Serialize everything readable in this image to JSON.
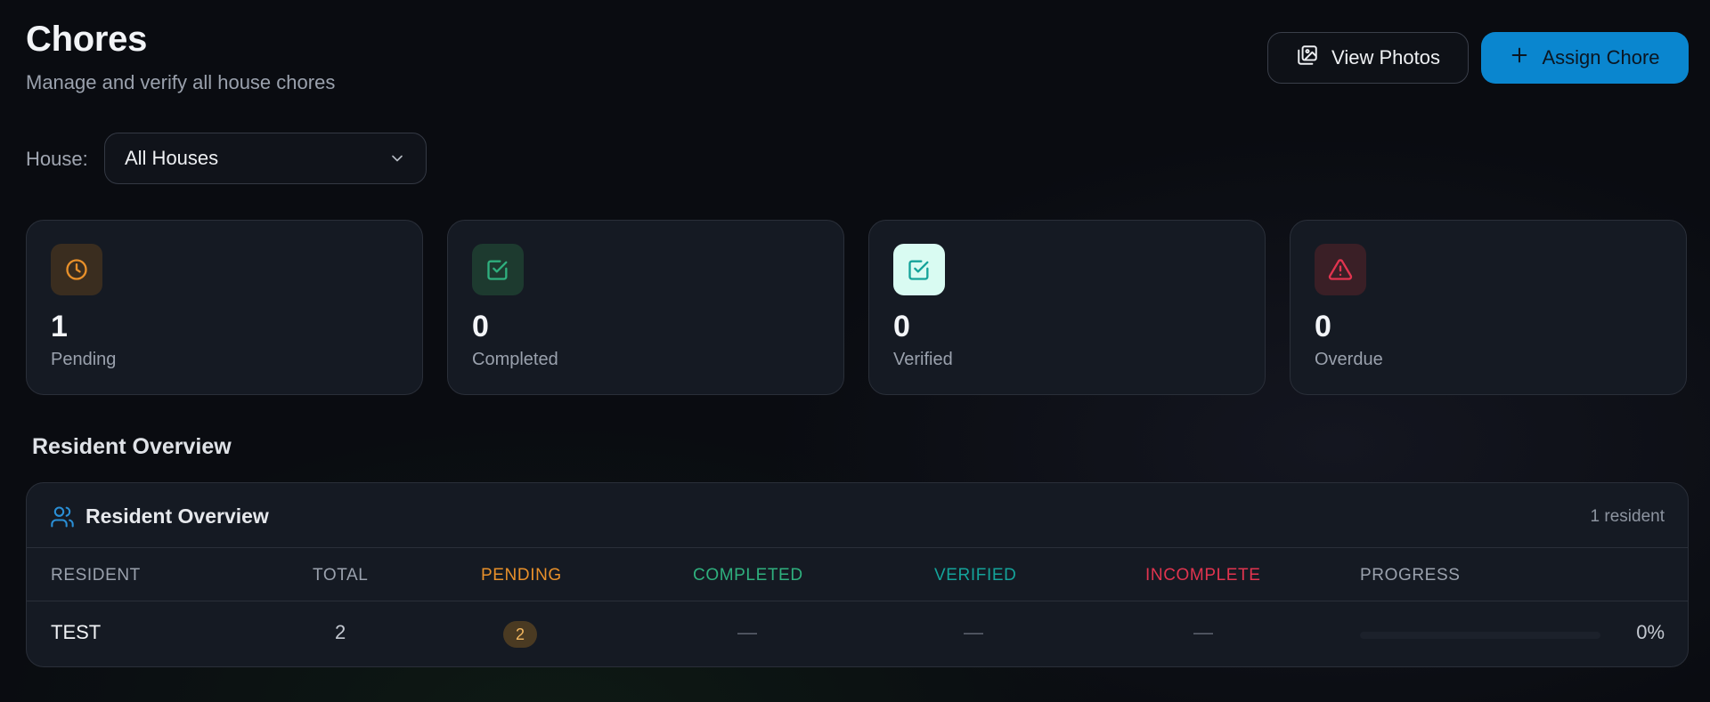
{
  "header": {
    "title": "Chores",
    "subtitle": "Manage and verify all house chores",
    "view_photos_label": "View Photos",
    "assign_chore_label": "Assign Chore"
  },
  "filter": {
    "house_label": "House:",
    "house_value": "All Houses"
  },
  "stats": [
    {
      "value": "1",
      "label": "Pending",
      "icon": "clock-icon",
      "color": "#e8902a",
      "bg": "#3a2d1f"
    },
    {
      "value": "0",
      "label": "Completed",
      "icon": "check-square-icon",
      "color": "#2fb07e",
      "bg": "#1d3a2f"
    },
    {
      "value": "0",
      "label": "Verified",
      "icon": "check-square-icon",
      "color": "#14a39a",
      "bg": "#d9fbf2"
    },
    {
      "value": "0",
      "label": "Overdue",
      "icon": "alert-triangle-icon",
      "color": "#e1344f",
      "bg": "#3a1f26"
    }
  ],
  "section": {
    "title": "Resident Overview"
  },
  "panel": {
    "title": "Resident Overview",
    "count": "1 resident",
    "columns": [
      {
        "label": "RESIDENT",
        "color": "#9aa1ad"
      },
      {
        "label": "TOTAL",
        "color": "#9aa1ad"
      },
      {
        "label": "PENDING",
        "color": "#e8902a"
      },
      {
        "label": "COMPLETED",
        "color": "#2fb07e"
      },
      {
        "label": "VERIFIED",
        "color": "#14a39a"
      },
      {
        "label": "INCOMPLETE",
        "color": "#e1344f"
      },
      {
        "label": "PROGRESS",
        "color": "#9aa1ad"
      }
    ],
    "rows": [
      {
        "resident": "TEST",
        "total": "2",
        "pending": "2",
        "completed": "—",
        "verified": "—",
        "incomplete": "—",
        "progress_pct": 0,
        "progress_label": "0%"
      }
    ]
  },
  "colors": {
    "accent": "#0a86cf",
    "pending": "#e8902a",
    "completed": "#2fb07e",
    "verified": "#14a39a",
    "overdue": "#e1344f"
  }
}
